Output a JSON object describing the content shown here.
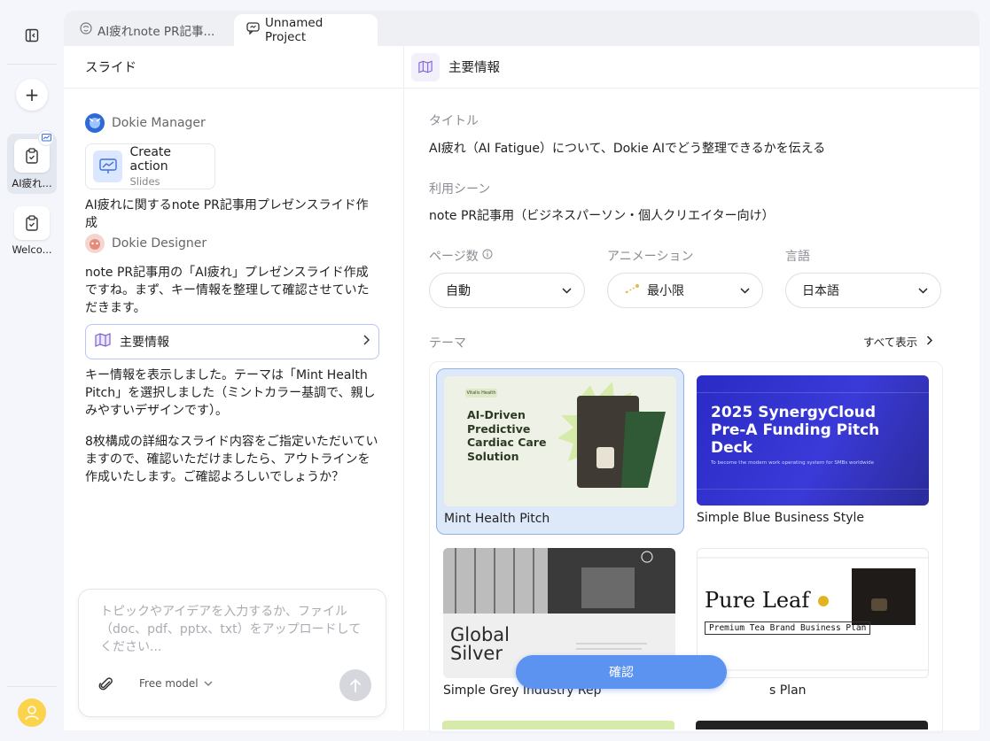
{
  "rail": {
    "items": [
      {
        "label": "AI疲れ..."
      },
      {
        "label": "Welco..."
      }
    ]
  },
  "tabs": [
    {
      "label": "AI疲れnote PR記事..."
    },
    {
      "label": "Unnamed Project"
    }
  ],
  "left": {
    "header": "スライド",
    "manager_name": "Dokie Manager",
    "action_title": "Create action",
    "action_subtitle": "Slides",
    "user_prompt": "AI疲れに関するnote PR記事用プレゼンスライド作成",
    "designer_name": "Dokie Designer",
    "msg1": "note PR記事用の「AI疲れ」プレゼンスライド作成ですね。まず、キー情報を整理して確認させていただきます。",
    "info_card_label": "主要情報",
    "msg2": "キー情報を表示しました。テーマは「Mint Health Pitch」を選択しました（ミントカラー基調で、親しみやすいデザインです）。",
    "msg3": "8枚構成の詳細なスライド内容をご指定いただいていますので、確認いただけましたら、アウトラインを作成いたします。ご確認よろしいでしょうか？",
    "composer_placeholder": "トピックやアイデアを入力するか、ファイル（doc、pdf、pptx、txt）をアップロードしてください...",
    "model_label": "Free model"
  },
  "right": {
    "header": "主要情報",
    "title_label": "タイトル",
    "title_value": "AI疲れ（AI Fatigue）について、Dokie AIでどう整理できるかを伝える",
    "scene_label": "利用シーン",
    "scene_value": "note PR記事用（ビジネスパーソン・個人クリエイター向け）",
    "pages_label": "ページ数",
    "pages_value": "自動",
    "animation_label": "アニメーション",
    "animation_value": "最小限",
    "language_label": "言語",
    "language_value": "日本語",
    "theme_label": "テーマ",
    "show_all": "すべて表示",
    "themes": [
      {
        "name": "Mint Health Pitch",
        "selected": true,
        "thumb_text": "AI-Driven Predictive Cardiac Care Solution",
        "thumb_tag": "Vitalis Health"
      },
      {
        "name": "Simple Blue Business Style",
        "selected": false,
        "thumb_text": "2025 SynergyCloud Pre-A Funding Pitch Deck",
        "thumb_sub": "To become the modern work operating system for SMBs worldwide"
      },
      {
        "name": "Simple Grey Industry Rep",
        "selected": false,
        "thumb_text": "Global Silver"
      },
      {
        "name": "s Plan",
        "selected": false,
        "thumb_text": "Pure Leaf",
        "thumb_sub": "Premium Tea Brand Business Plan"
      }
    ],
    "confirm_label": "確認"
  },
  "colors": {
    "accent": "#5c92f0",
    "selected_card": "#dde8f9",
    "mint": "#d5ecb4",
    "deep_blue": "#2f2fd0"
  }
}
